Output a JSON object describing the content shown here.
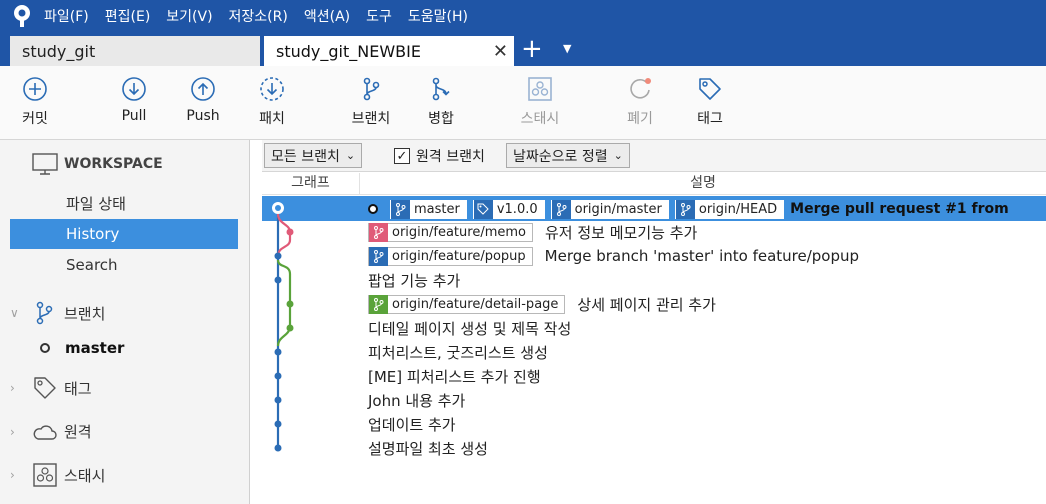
{
  "menu": [
    "파일(F)",
    "편집(E)",
    "보기(V)",
    "저장소(R)",
    "액션(A)",
    "도구",
    "도움말(H)"
  ],
  "tabs": [
    {
      "label": "study_git",
      "active": false
    },
    {
      "label": "study_git_NEWBIE",
      "active": true
    }
  ],
  "toolbar": {
    "commit": "커밋",
    "pull": "Pull",
    "push": "Push",
    "patch": "패치",
    "branch": "브랜치",
    "merge": "병합",
    "stash": "스태시",
    "discard": "폐기",
    "tag": "태그"
  },
  "sidebar": {
    "workspace": "WORKSPACE",
    "file_status": "파일 상태",
    "history": "History",
    "search": "Search",
    "branches": "브랜치",
    "master": "master",
    "tags": "태그",
    "remotes": "원격",
    "stashes": "스태시"
  },
  "filter": {
    "branch_select": "모든 브랜치",
    "remote_branch_label": "원격 브랜치",
    "remote_branch_checked": true,
    "sort_select": "날짜순으로 정렬"
  },
  "columns": {
    "graph": "그래프",
    "description": "설명"
  },
  "commits": [
    {
      "refs": [
        "master",
        "v1.0.0",
        "origin/master",
        "origin/HEAD"
      ],
      "message": "Merge pull request #1 from",
      "selected": true
    },
    {
      "refs": [
        "origin/feature/memo"
      ],
      "message": "유저 정보 메모기능 추가"
    },
    {
      "refs": [
        "origin/feature/popup"
      ],
      "message": "Merge branch 'master' into feature/popup"
    },
    {
      "refs": [],
      "message": "팝업 기능 추가"
    },
    {
      "refs": [
        "origin/feature/detail-page"
      ],
      "message": "상세 페이지 관리 추가"
    },
    {
      "refs": [],
      "message": "디테일 페이지 생성 및 제목 작성"
    },
    {
      "refs": [],
      "message": "피처리스트, 굿즈리스트 생성"
    },
    {
      "refs": [],
      "message": "[ME] 피처리스트 추가 진행"
    },
    {
      "refs": [],
      "message": "John 내용 추가"
    },
    {
      "refs": [],
      "message": "업데이트 추가"
    },
    {
      "refs": [],
      "message": "설명파일 최초 생성"
    }
  ],
  "colors": {
    "menubar": "#1f55a6",
    "selection": "#3c8fde",
    "graph_main": "#2b6cb5",
    "graph_memo": "#e05a78",
    "graph_feature": "#5aa33a"
  }
}
